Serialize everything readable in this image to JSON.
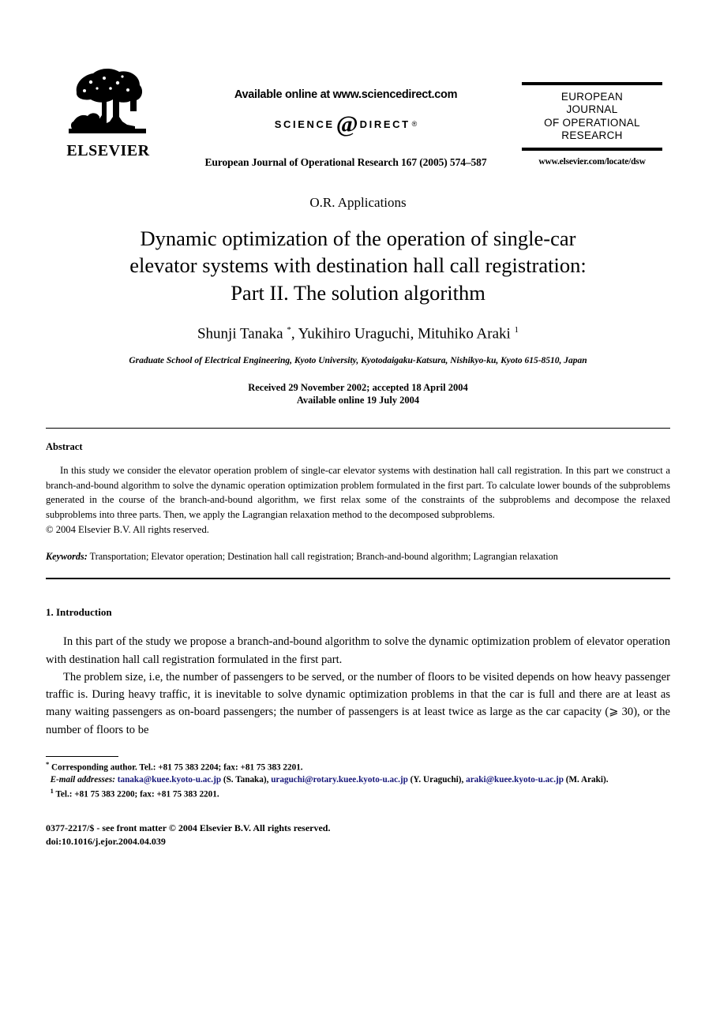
{
  "header": {
    "publisher_logo_name": "ELSEVIER",
    "available_online": "Available online at www.sciencedirect.com",
    "sciencedirect_left": "SCIENCE",
    "sciencedirect_at": "@",
    "sciencedirect_right": "DIRECT",
    "sciencedirect_reg": "®",
    "journal_reference": "European Journal of Operational Research 167 (2005) 574–587",
    "emblem_line1": "EUROPEAN",
    "emblem_line2": "JOURNAL",
    "emblem_line3": "OF OPERATIONAL",
    "emblem_line4": "RESEARCH",
    "emblem_url": "www.elsevier.com/locate/dsw"
  },
  "article": {
    "category": "O.R. Applications",
    "title_line1": "Dynamic optimization of the operation of single-car",
    "title_line2": "elevator systems with destination hall call registration:",
    "title_line3": "Part II. The solution algorithm",
    "authors_text": "Shunji Tanaka ",
    "author_star": "*",
    "authors_text2": ", Yukihiro Uraguchi, Mituhiko Araki ",
    "author_footnote_mark": "1",
    "affiliation": "Graduate School of Electrical Engineering, Kyoto University, Kyotodaigaku-Katsura, Nishikyo-ku, Kyoto 615-8510, Japan",
    "received_line": "Received 29 November 2002; accepted 18 April 2004",
    "available_line": "Available online 19 July 2004"
  },
  "abstract": {
    "heading": "Abstract",
    "body": "In this study we consider the elevator operation problem of single-car elevator systems with destination hall call registration. In this part we construct a branch-and-bound algorithm to solve the dynamic operation optimization problem formulated in the first part. To calculate lower bounds of the subproblems generated in the course of the branch-and-bound algorithm, we first relax some of the constraints of the subproblems and decompose the relaxed subproblems into three parts. Then, we apply the Lagrangian relaxation method to the decomposed subproblems.",
    "copyright": "© 2004 Elsevier B.V. All rights reserved.",
    "keywords_label": "Keywords:",
    "keywords_value": " Transportation; Elevator operation; Destination hall call registration; Branch-and-bound algorithm; Lagrangian relaxation"
  },
  "introduction": {
    "heading": "1. Introduction",
    "para1": "In this part of the study we propose a branch-and-bound algorithm to solve the dynamic optimization problem of elevator operation with destination hall call registration formulated in the first part.",
    "para2": "The problem size, i.e, the number of passengers to be served, or the number of floors to be visited depends on how heavy passenger traffic is. During heavy traffic, it is inevitable to solve dynamic optimization problems in that the car is full and there are at least as many waiting passengers as on-board passengers; the number of passengers is at least twice as large as the car capacity (⩾ 30), or the number of floors to be"
  },
  "footnotes": {
    "corresponding_mark": "*",
    "corresponding": " Corresponding author. Tel.: +81 75 383 2204; fax: +81 75 383 2201.",
    "email_label": "E-mail addresses:",
    "email1": "tanaka@kuee.kyoto-u.ac.jp",
    "email1_attrib": " (S. Tanaka), ",
    "email2": "uraguchi@rotary.kuee.kyoto-u.ac.jp",
    "email2_attrib": " (Y. Uraguchi), ",
    "email3": "araki@kuee.kyoto-u.ac.jp",
    "email3_attrib": " (M. Araki).",
    "footnote1_mark": "1",
    "footnote1": " Tel.: +81 75 383 2200; fax: +81 75 383 2201."
  },
  "page_footer": {
    "issn_line": "0377-2217/$ - see front matter © 2004 Elsevier B.V. All rights reserved.",
    "doi_line": "doi:10.1016/j.ejor.2004.04.039"
  }
}
